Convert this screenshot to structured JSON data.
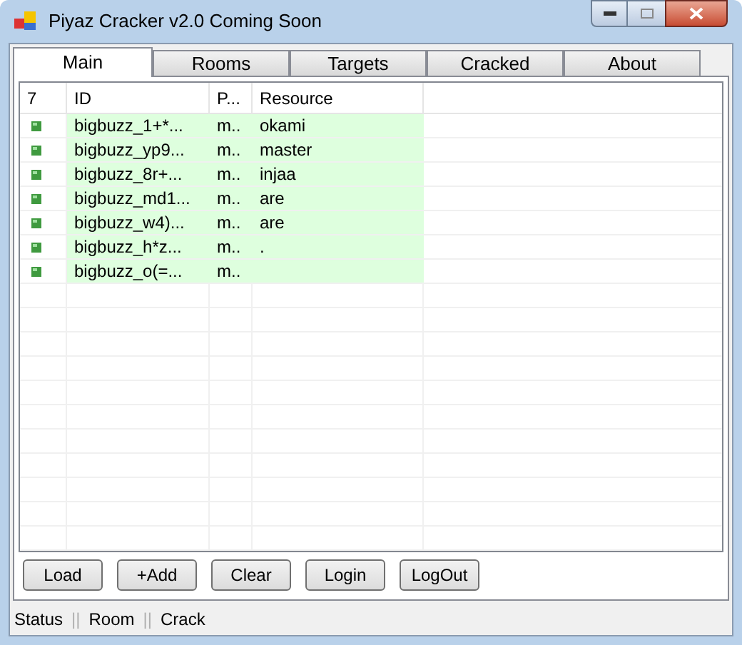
{
  "window": {
    "title": "Piyaz Cracker v2.0 Coming Soon"
  },
  "tabs": [
    {
      "label": "Main",
      "selected": true
    },
    {
      "label": "Rooms",
      "selected": false
    },
    {
      "label": "Targets",
      "selected": false
    },
    {
      "label": "Cracked",
      "selected": false
    },
    {
      "label": "About",
      "selected": false
    }
  ],
  "table": {
    "columns": [
      "7",
      "ID",
      "P...",
      "Resource"
    ],
    "rows": [
      {
        "id": "bigbuzz_1+*...",
        "column_3": "m..",
        "resource": "okami"
      },
      {
        "id": "bigbuzz_yp9...",
        "column_3": "m..",
        "resource": "master"
      },
      {
        "id": "bigbuzz_8r+...",
        "column_3": "m..",
        "resource": "injaa"
      },
      {
        "id": "bigbuzz_md1...",
        "column_3": "m..",
        "resource": "are"
      },
      {
        "id": "bigbuzz_w4)...",
        "column_3": "m..",
        "resource": "are"
      },
      {
        "id": "bigbuzz_h*z...",
        "column_3": "m..",
        "resource": "."
      },
      {
        "id": "bigbuzz_o(=...",
        "column_3": "m.."
      }
    ]
  },
  "buttons": [
    "Load",
    "+Add",
    "Clear",
    "Login",
    "LogOut"
  ],
  "status_bar": [
    {
      "kind": "label",
      "text": "Status"
    },
    {
      "kind": "separator",
      "text": "||"
    },
    {
      "kind": "label",
      "text": "Room"
    },
    {
      "kind": "separator",
      "text": "||"
    },
    {
      "kind": "label",
      "text": "Crack"
    }
  ]
}
